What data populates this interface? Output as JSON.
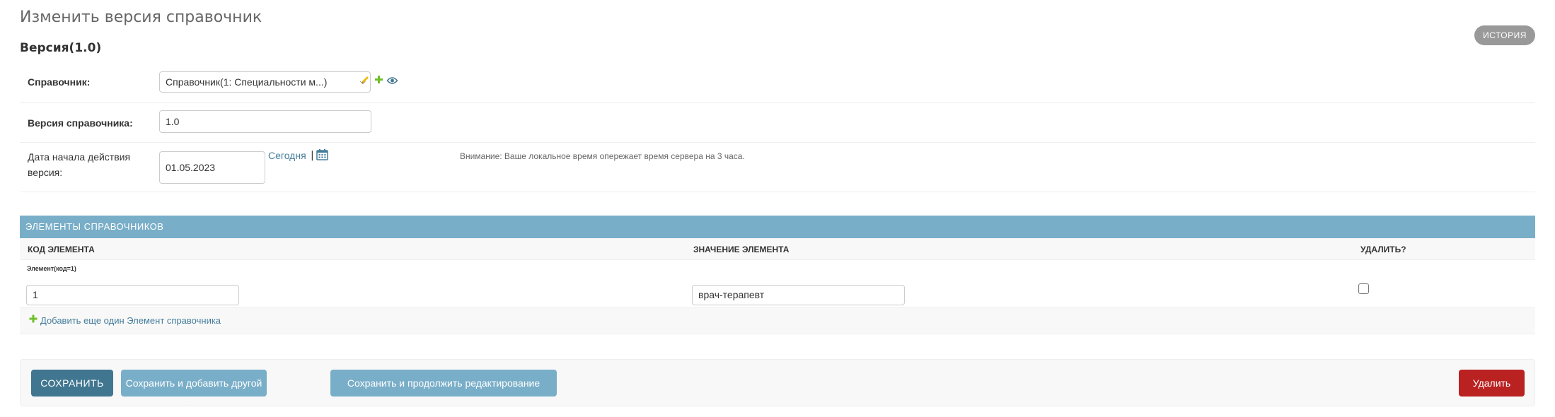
{
  "header": {
    "title": "Изменить версия справочник",
    "history_label": "История",
    "version_heading": "Версия(1.0)"
  },
  "fields": {
    "reference": {
      "label": "Справочник:",
      "selected": "Справочник(1: Специальности м...)"
    },
    "version": {
      "label": "Версия справочника:",
      "value": "1.0"
    },
    "start_date": {
      "label_line1": "Дата начала действия",
      "label_line2": "версия:",
      "value": "01.05.2023",
      "today_label": "Сегодня",
      "separator": "|",
      "timezone_note": "Внимание: Ваше локальное время опережает время сервера на 3 часа."
    }
  },
  "inline": {
    "title": "Элементы справочников",
    "columns": [
      "Код элемента",
      "Значение элемента",
      "Удалить?"
    ],
    "rows": [
      {
        "title": "Элемент(код=1)",
        "code": "1",
        "value": "врач-терапевт"
      }
    ],
    "add_label": "Добавить еще один Элемент справочника"
  },
  "actions": {
    "save": "Сохранить",
    "save_add_another": "Сохранить и добавить другой объект",
    "save_continue": "Сохранить и продолжить редактирование",
    "delete": "Удалить"
  },
  "colors": {
    "header_bar": "#79aec8",
    "primary": "#417690",
    "link": "#447e9b",
    "danger": "#ba2121",
    "add": "#70bf2b",
    "edit": "#efb80b"
  }
}
